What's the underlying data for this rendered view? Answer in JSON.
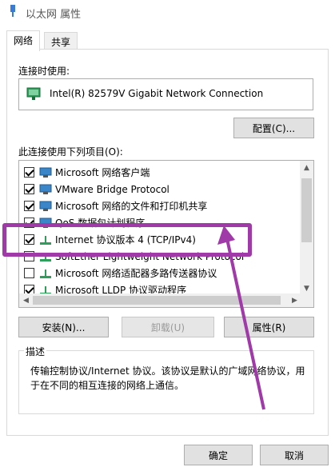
{
  "window": {
    "title": "以太网 属性"
  },
  "tabs": [
    {
      "label": "网络"
    },
    {
      "label": "共享"
    }
  ],
  "connect_using": {
    "label": "连接时使用:",
    "adapter_name": "Intel(R) 82579V Gigabit Network Connection",
    "configure_button": "配置(C)..."
  },
  "items_label": "此连接使用下列项目(O):",
  "items": [
    {
      "label": "Microsoft 网络客户端",
      "checked": true,
      "icon": "network-client-icon"
    },
    {
      "label": "VMware Bridge Protocol",
      "checked": true,
      "icon": "network-service-icon"
    },
    {
      "label": "Microsoft 网络的文件和打印机共享",
      "checked": true,
      "icon": "network-service-icon"
    },
    {
      "label": "QoS 数据包计划程序",
      "checked": true,
      "icon": "network-service-icon"
    },
    {
      "label": "Internet 协议版本 4 (TCP/IPv4)",
      "checked": true,
      "icon": "protocol-icon"
    },
    {
      "label": "SoftEther Lightweight Network Protocol",
      "checked": false,
      "icon": "protocol-icon"
    },
    {
      "label": "Microsoft 网络适配器多路传送器协议",
      "checked": false,
      "icon": "protocol-icon"
    },
    {
      "label": "Microsoft LLDP 协议驱动程序",
      "checked": true,
      "icon": "protocol-icon"
    }
  ],
  "buttons": {
    "install": "安装(N)...",
    "uninstall": "卸载(U)",
    "properties": "属性(R)"
  },
  "description": {
    "label": "描述",
    "text": "传输控制协议/Internet 协议。该协议是默认的广域网络协议，用于在不同的相互连接的网络上通信。"
  },
  "footer": {
    "ok": "确定",
    "cancel": "取消"
  },
  "colors": {
    "highlight": "#a03aa8"
  }
}
